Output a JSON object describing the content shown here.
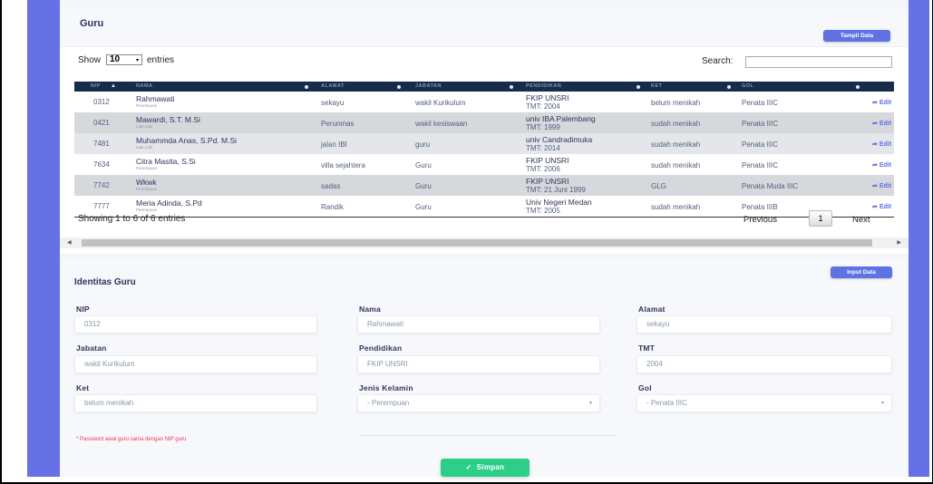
{
  "colors": {
    "sidebar_bg": "#6671e6",
    "primary": "#5e72e4",
    "header_dark": "#172b4d",
    "success": "#2dce89",
    "danger": "#f5365c"
  },
  "card1": {
    "title": "Guru",
    "show_data_button": "Tampil Data",
    "show_label": "Show",
    "entries_value": "10",
    "entries_label": "entries",
    "search_label": "Search:",
    "search_value": "",
    "columns": [
      "NIP",
      "NAMA",
      "ALAMAT",
      "JABATAN",
      "PENDIDIKAN",
      "KET",
      "GOL"
    ],
    "rows": [
      {
        "nip": "0312",
        "nama": "Rahmawati",
        "jk": "Perempuan",
        "alamat": "sekayu",
        "jabatan": "wakil Kurikulum",
        "pendidikan": "FKIP UNSRI",
        "tmt": "TMT: 2004",
        "ket": "belum menikah",
        "gol": "Penata IIIC",
        "edit": "Edit"
      },
      {
        "nip": "0421",
        "nama": "Mawardi, S.T. M.Si",
        "jk": "Laki-Laki",
        "alamat": "Perumnas",
        "jabatan": "wakil kesiswaan",
        "pendidikan": "univ IBA Palembang",
        "tmt": "TMT: 1999",
        "ket": "sudah menikah",
        "gol": "Penata IIIC",
        "edit": "Edit"
      },
      {
        "nip": "7481",
        "nama": "Muhammda Anas, S.Pd. M.Si",
        "jk": "Laki-Laki",
        "alamat": "jalan IBI",
        "jabatan": "guru",
        "pendidikan": "univ Candradimuka",
        "tmt": "TMT: 2014",
        "ket": "sudah menikah",
        "gol": "Penata IIIC",
        "edit": "Edit"
      },
      {
        "nip": "7634",
        "nama": "Citra Masita, S.Si",
        "jk": "Perempuan",
        "alamat": "villa sejahtera",
        "jabatan": "Guru",
        "pendidikan": "FKIP UNSRI",
        "tmt": "TMT: 2006",
        "ket": "sudah menikah",
        "gol": "Penata IIIC",
        "edit": "Edit"
      },
      {
        "nip": "7742",
        "nama": "Wkwk",
        "jk": "Perempuan",
        "alamat": "sadas",
        "jabatan": "Guru",
        "pendidikan": "FKIP UNSRI",
        "tmt": "TMT: 21 Juni 1999",
        "ket": "GLG",
        "gol": "Penata Muda IIIC",
        "edit": "Edit"
      },
      {
        "nip": "7777",
        "nama": "Meria Adinda, S.Pd",
        "jk": "Perempuan",
        "alamat": "Randik",
        "jabatan": "Guru",
        "pendidikan": "Univ Negeri Medan",
        "tmt": "TMT: 2005",
        "ket": "sudah menikah",
        "gol": "Penata IIIB",
        "edit": "Edit"
      }
    ],
    "info": "Showing 1 to 6 of 6 entries",
    "prev": "Previous",
    "page": "1",
    "next": "Next"
  },
  "form": {
    "title": "Identitas Guru",
    "input_button": "Input Data",
    "fields": {
      "nip": {
        "label": "NIP",
        "value": "0312"
      },
      "nama": {
        "label": "Nama",
        "value": "Rahmawati"
      },
      "alamat": {
        "label": "Alamat",
        "value": "sekayu"
      },
      "jabatan": {
        "label": "Jabatan",
        "value": "wakil Kurikulum"
      },
      "pendidikan": {
        "label": "Pendidikan",
        "value": "FKIP UNSRI"
      },
      "tmt": {
        "label": "TMT",
        "value": "2004"
      },
      "ket": {
        "label": "Ket",
        "value": "belum menikah"
      },
      "jk": {
        "label": "Jenis Kelamin",
        "value": "- Perempuan"
      },
      "gol": {
        "label": "Gol",
        "value": "- Penata IIIC"
      }
    },
    "note": "* Password awal guru sama dengan NIP guru",
    "save_icon": "check-icon",
    "save": "Simpan"
  }
}
